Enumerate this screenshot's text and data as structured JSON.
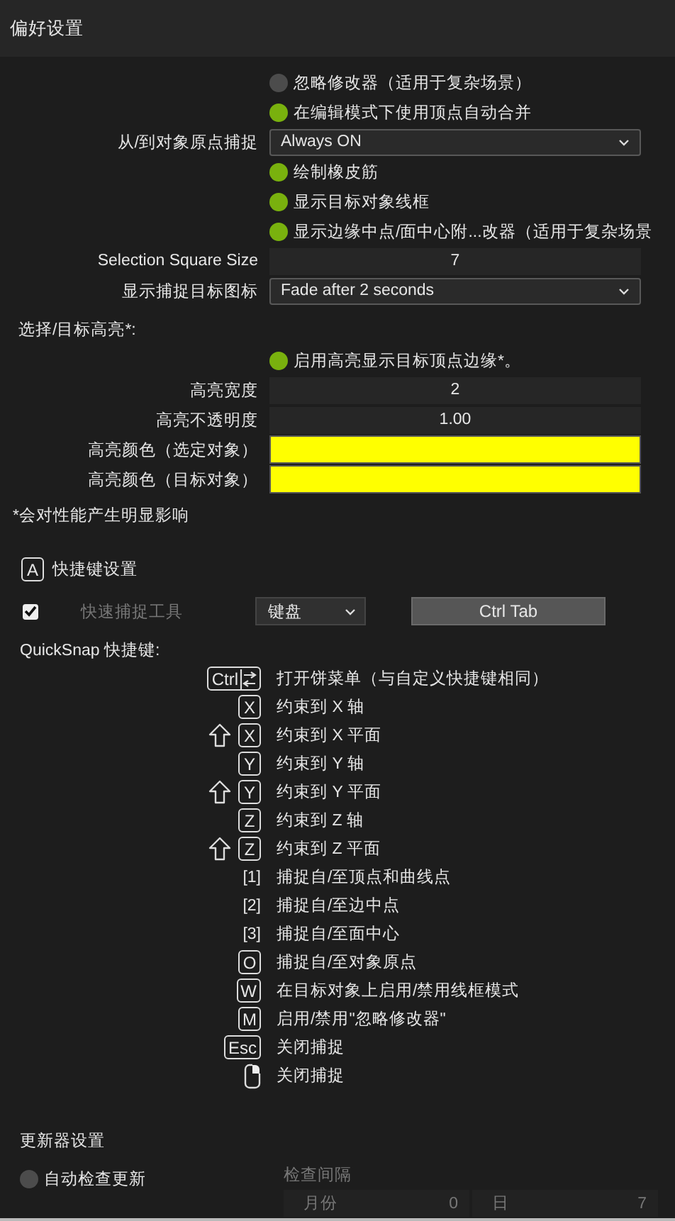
{
  "title": "偏好设置",
  "general": {
    "rows": [
      {
        "kind": "toggle",
        "label": "忽略修改器（适用于复杂场景）",
        "on": false
      },
      {
        "kind": "toggle",
        "label": "在编辑模式下使用顶点自动合并",
        "on": true
      },
      {
        "kind": "dropdown",
        "label": "从/到对象原点捕捉",
        "value": "Always ON"
      },
      {
        "kind": "toggle",
        "label": "绘制橡皮筋",
        "on": true
      },
      {
        "kind": "toggle",
        "label": "显示目标对象线框",
        "on": true
      },
      {
        "kind": "toggle",
        "label": "显示边缘中点/面中心附...改器（适用于复杂场景",
        "on": true
      },
      {
        "kind": "number",
        "label": "Selection Square Size",
        "value": "7"
      },
      {
        "kind": "dropdown",
        "label": "显示捕捉目标图标",
        "value": "Fade after 2 seconds"
      }
    ]
  },
  "highlight": {
    "heading": "选择/目标高亮*:",
    "rows": [
      {
        "kind": "toggle",
        "label": "启用高亮显示目标顶点边缘*。",
        "on": true
      },
      {
        "kind": "number",
        "label": "高亮宽度",
        "value": "2"
      },
      {
        "kind": "number",
        "label": "高亮不透明度",
        "value": "1.00"
      },
      {
        "kind": "color",
        "label": "高亮颜色（选定对象）",
        "color": "#ffff00"
      },
      {
        "kind": "color",
        "label": "高亮颜色（目标对象）",
        "color": "#ffff00"
      }
    ],
    "note": "*会对性能产生明显影响"
  },
  "shortcuts": {
    "key": "A",
    "heading": "快捷键设置",
    "tool": {
      "checked": true,
      "label": "快速捕捉工具",
      "disabled": true,
      "device": "键盘",
      "hotkey": "Ctrl Tab"
    }
  },
  "quicksnap": {
    "heading": "QuickSnap 快捷键:",
    "items": [
      {
        "keys": [
          {
            "kind": "cap-tab",
            "label": "Ctrl"
          }
        ],
        "action": "打开饼菜单（与自定义快捷键相同）"
      },
      {
        "keys": [
          {
            "kind": "cap",
            "label": "X"
          }
        ],
        "action": "约束到 X 轴"
      },
      {
        "keys": [
          {
            "kind": "shift"
          },
          {
            "kind": "cap",
            "label": "X"
          }
        ],
        "action": "约束到 X 平面"
      },
      {
        "keys": [
          {
            "kind": "cap",
            "label": "Y"
          }
        ],
        "action": "约束到 Y 轴"
      },
      {
        "keys": [
          {
            "kind": "shift"
          },
          {
            "kind": "cap",
            "label": "Y"
          }
        ],
        "action": "约束到 Y 平面"
      },
      {
        "keys": [
          {
            "kind": "cap",
            "label": "Z"
          }
        ],
        "action": "约束到 Z 轴"
      },
      {
        "keys": [
          {
            "kind": "shift"
          },
          {
            "kind": "cap",
            "label": "Z"
          }
        ],
        "action": "约束到 Z 平面"
      },
      {
        "keys": [
          {
            "kind": "plain",
            "label": "[1]"
          }
        ],
        "action": "捕捉自/至顶点和曲线点"
      },
      {
        "keys": [
          {
            "kind": "plain",
            "label": "[2]"
          }
        ],
        "action": "捕捉自/至边中点"
      },
      {
        "keys": [
          {
            "kind": "plain",
            "label": "[3]"
          }
        ],
        "action": "捕捉自/至面中心"
      },
      {
        "keys": [
          {
            "kind": "cap",
            "label": "O"
          }
        ],
        "action": "捕捉自/至对象原点"
      },
      {
        "keys": [
          {
            "kind": "cap",
            "label": "W"
          }
        ],
        "action": "在目标对象上启用/禁用线框模式"
      },
      {
        "keys": [
          {
            "kind": "cap",
            "label": "M"
          }
        ],
        "action": "启用/禁用\"忽略修改器\""
      },
      {
        "keys": [
          {
            "kind": "cap",
            "label": "Esc"
          }
        ],
        "action": "关闭捕捉"
      },
      {
        "keys": [
          {
            "kind": "mouse"
          }
        ],
        "action": "关闭捕捉"
      }
    ]
  },
  "updater": {
    "heading": "更新器设置",
    "auto_check": {
      "label": "自动检查更新",
      "on": false
    },
    "interval": {
      "label": "检查间隔",
      "disabled": true,
      "fields": [
        {
          "label": "月份",
          "value": "0"
        },
        {
          "label": "日",
          "value": "7"
        }
      ]
    }
  }
}
